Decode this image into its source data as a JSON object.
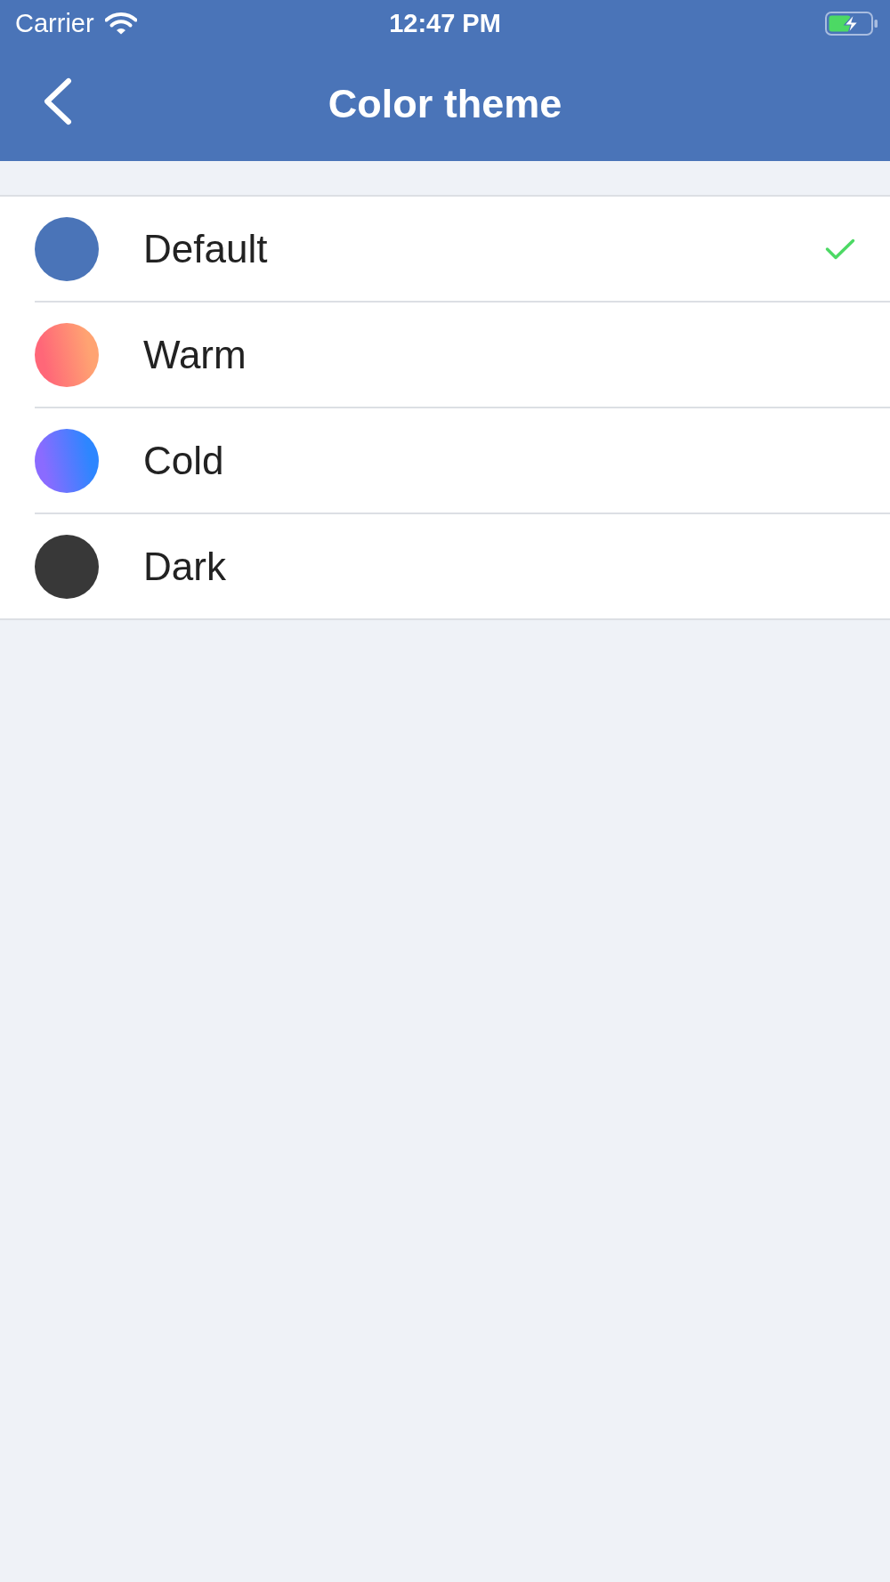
{
  "status_bar": {
    "carrier": "Carrier",
    "time": "12:47 PM"
  },
  "header": {
    "title": "Color theme"
  },
  "themes": [
    {
      "name": "Default",
      "selected": true,
      "kind": "solid",
      "color": "#4a74b8"
    },
    {
      "name": "Warm",
      "selected": false,
      "kind": "gradient",
      "gradient": [
        {
          "color": "#ff6778"
        },
        {
          "color": "#ffa372"
        }
      ]
    },
    {
      "name": "Cold",
      "selected": false,
      "kind": "gradient",
      "gradient": [
        {
          "color": "#8a6bff"
        },
        {
          "color": "#2d86ff"
        }
      ]
    },
    {
      "name": "Dark",
      "selected": false,
      "kind": "solid",
      "color": "#383838"
    }
  ]
}
